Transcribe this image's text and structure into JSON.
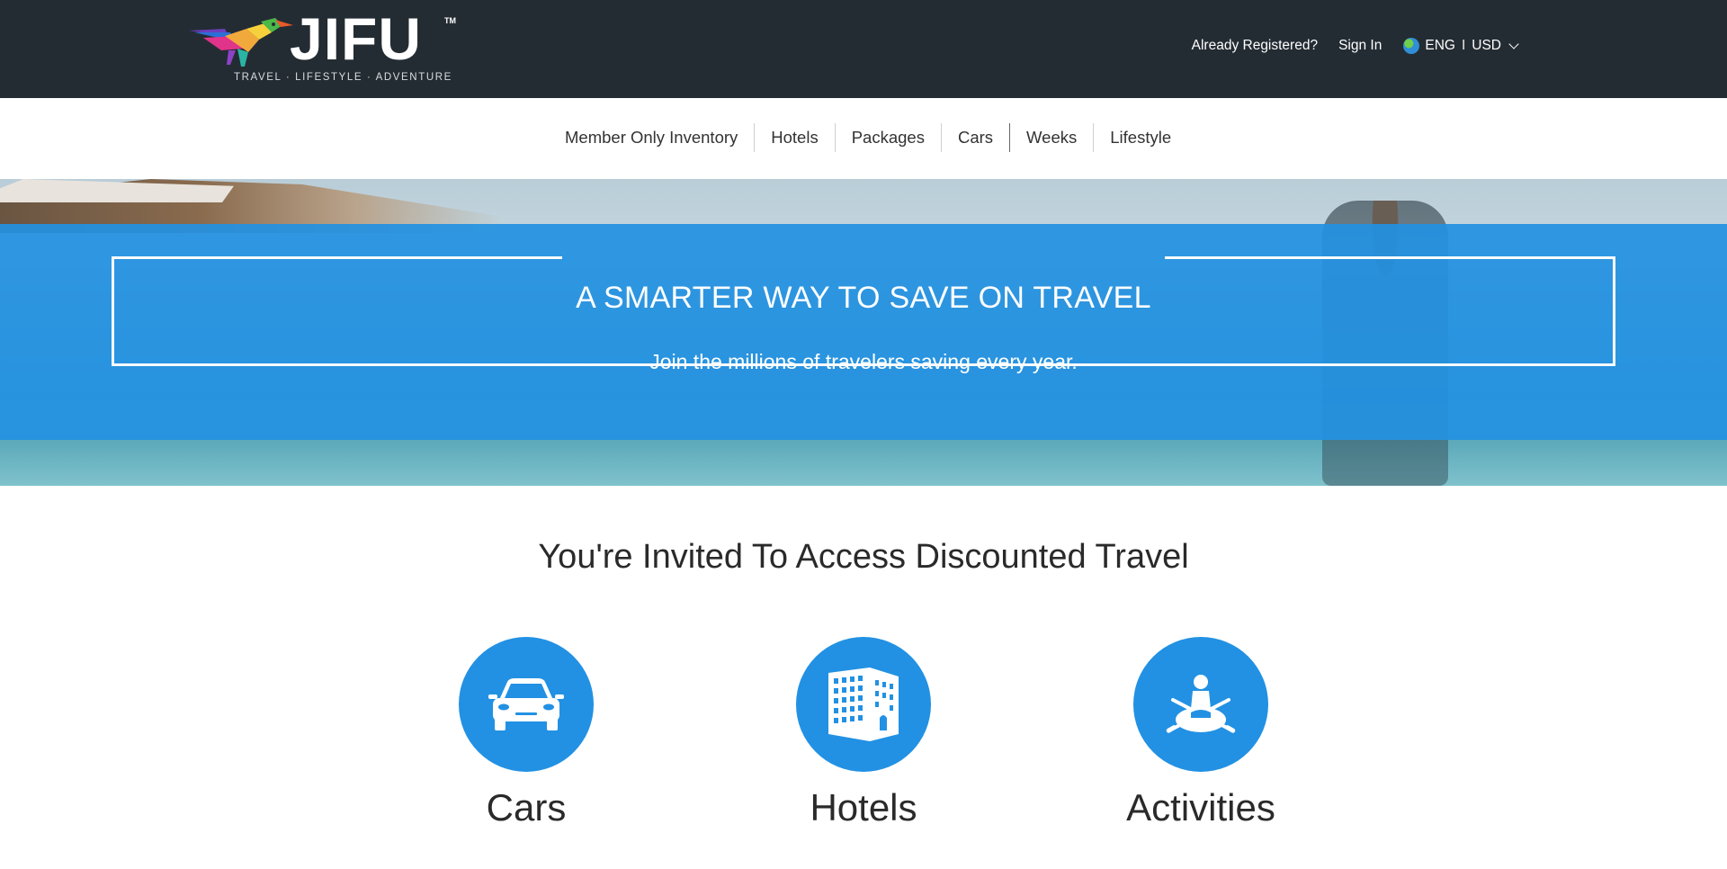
{
  "header": {
    "logo": {
      "wordmark": "JIFU",
      "trademark": "TM",
      "tagline": "TRAVEL · LIFESTYLE · ADVENTURE"
    },
    "already_registered": "Already Registered?",
    "sign_in": "Sign In",
    "language": "ENG",
    "separator": "I",
    "currency": "USD"
  },
  "nav": {
    "items": [
      "Member Only Inventory",
      "Hotels",
      "Packages",
      "Cars",
      "Weeks",
      "Lifestyle"
    ]
  },
  "hero": {
    "title": "A SMARTER WAY TO SAVE ON TRAVEL",
    "subtitle": "Join the millions of travelers saving every year."
  },
  "invite": {
    "title": "You're Invited To Access Discounted Travel",
    "features": [
      {
        "label": "Cars",
        "icon": "car-icon"
      },
      {
        "label": "Hotels",
        "icon": "hotel-building-icon"
      },
      {
        "label": "Activities",
        "icon": "kayak-activity-icon"
      }
    ]
  },
  "colors": {
    "header_bg": "#242c33",
    "accent_blue": "#2291e3",
    "hero_band": "#2391e1"
  }
}
